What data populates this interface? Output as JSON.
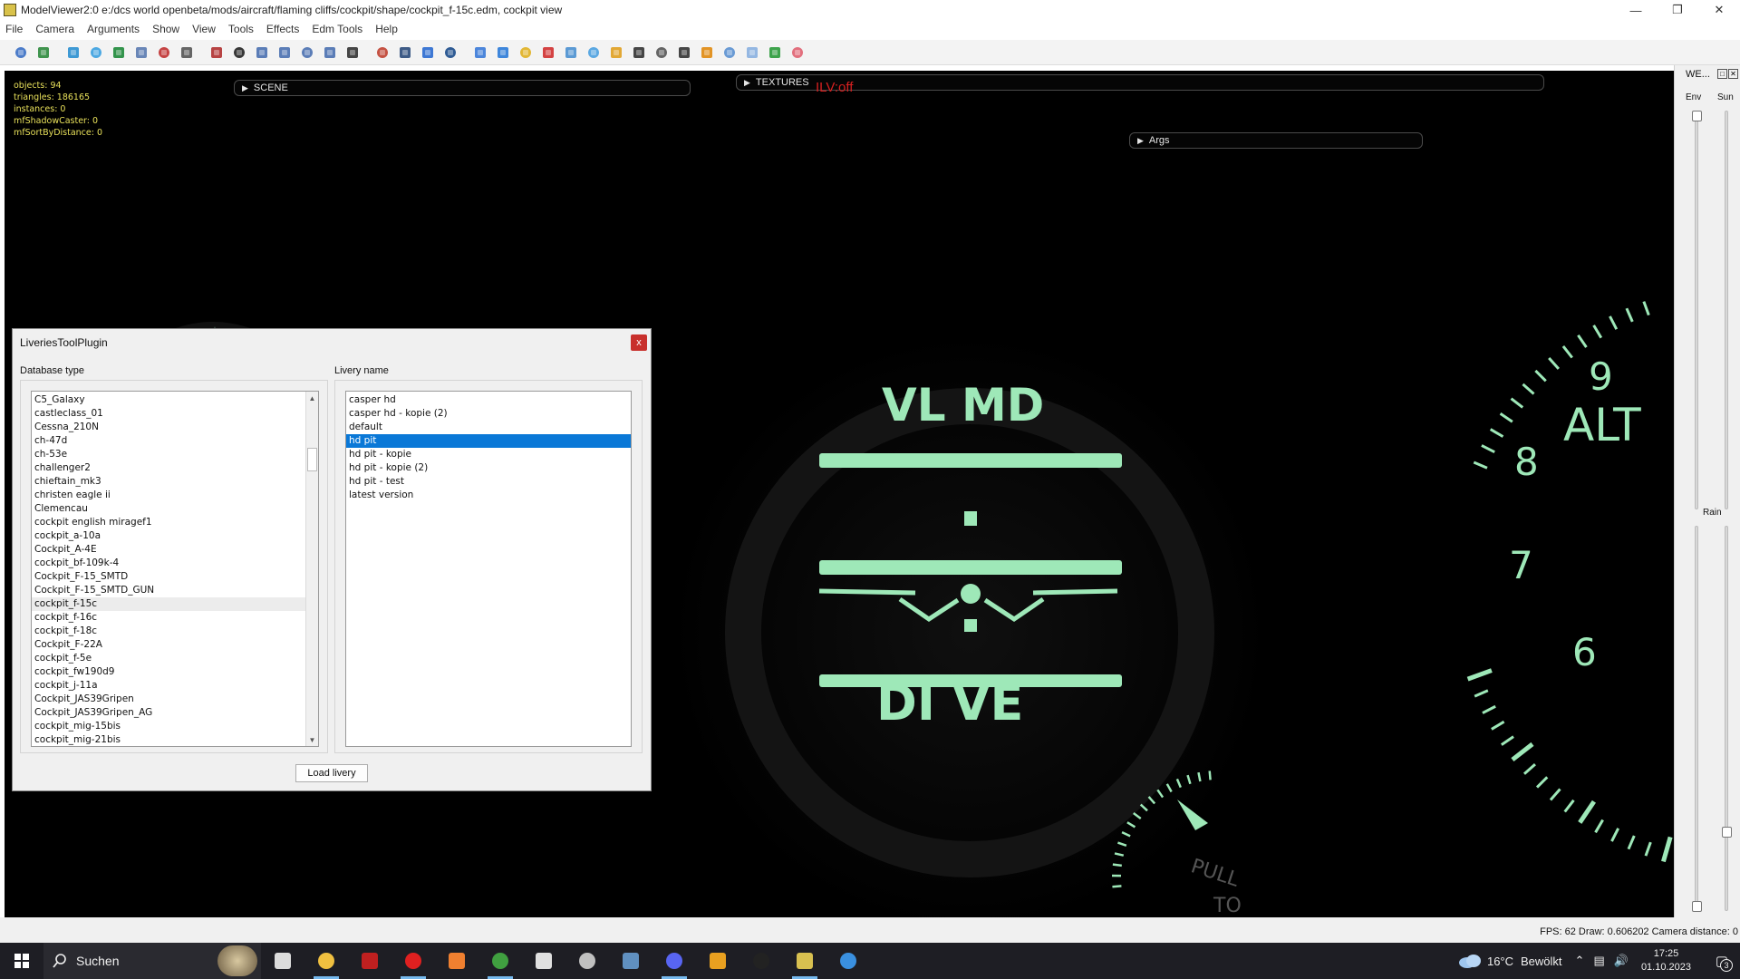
{
  "window": {
    "title": "ModelViewer2:0 e:/dcs world openbeta/mods/aircraft/flaming cliffs/cockpit/shape/cockpit_f-15c.edm, cockpit view",
    "controls": [
      "—",
      "❐",
      "✕"
    ]
  },
  "menu": [
    "File",
    "Camera",
    "Arguments",
    "Show",
    "View",
    "Tools",
    "Effects",
    "Edm Tools",
    "Help"
  ],
  "toolbar_icons": [
    "save-icon",
    "open-icon",
    "globe-icon",
    "refresh-icon",
    "reload-icon",
    "window-icon",
    "image-icon",
    "search-icon",
    "crosshair-icon",
    "grid-icon",
    "filter-icon",
    "light-icon",
    "arrow-icon",
    "sound-icon",
    "camera-icon",
    "layers-icon",
    "screen-icon",
    "undo-icon",
    "record-icon",
    "chart-icon",
    "cube-icon",
    "folder-icon",
    "box-icon",
    "panel-icon",
    "texture-icon",
    "graph-icon",
    "pin-icon",
    "hat-icon",
    "car-icon",
    "sun-icon",
    "nodes-icon",
    "mesh-icon",
    "dots-icon",
    "target-icon"
  ],
  "overlay": {
    "stats": [
      "objects: 94",
      "triangles: 186165",
      "instances: 0",
      "mfShadowCaster: 0",
      "mfSortByDistance: 0"
    ],
    "scene_label": "SCENE",
    "textures_label": "TEXTURES",
    "ilv_label": "ILV:off",
    "args_label": "Args",
    "arrow_glyph": "▶"
  },
  "cockpit": {
    "adi_top_text": "VL MD",
    "adi_bottom_text": "DI VE",
    "alt_label": "ALT",
    "alt_numbers": [
      "9",
      "8",
      "7",
      "6"
    ],
    "pull_label": "PULL",
    "to_label": "TO",
    "glow_color": "#9ee8b8"
  },
  "right_panel": {
    "title": "WE...",
    "env_label": "Env",
    "sun_label": "Sun",
    "rain_label": "Rain"
  },
  "dialog": {
    "title": "LiveriesToolPlugin",
    "close_glyph": "x",
    "database_label": "Database type",
    "livery_label": "Livery name",
    "load_button": "Load livery",
    "database_items": [
      "C5_Galaxy",
      "castleclass_01",
      "Cessna_210N",
      "ch-47d",
      "ch-53e",
      "challenger2",
      "chieftain_mk3",
      "christen eagle ii",
      "Clemencau",
      "cockpit english miragef1",
      "cockpit_a-10a",
      "Cockpit_A-4E",
      "cockpit_bf-109k-4",
      "Cockpit_F-15_SMTD",
      "Cockpit_F-15_SMTD_GUN",
      "cockpit_f-15c",
      "cockpit_f-16c",
      "cockpit_f-18c",
      "Cockpit_F-22A",
      "cockpit_f-5e",
      "cockpit_fw190d9",
      "cockpit_j-11a",
      "Cockpit_JAS39Gripen",
      "Cockpit_JAS39Gripen_AG",
      "cockpit_mig-15bis",
      "cockpit_mig-21bis"
    ],
    "database_selected": "cockpit_f-15c",
    "livery_items": [
      "casper hd",
      "casper hd - kopie (2)",
      "default",
      "hd pit",
      "hd pit - kopie",
      "hd pit - kopie (2)",
      "hd pit - test",
      "latest version"
    ],
    "livery_selected": "hd pit",
    "scroll_glyph_up": "▲",
    "scroll_glyph_down": "▼"
  },
  "status_bar": {
    "text": "FPS: 62  Draw: 0.606202  Camera distance: 0"
  },
  "taskbar": {
    "search_label": "Suchen",
    "apps": [
      "task-view-icon",
      "file-explorer-icon",
      "red-app-icon",
      "opera-icon",
      "media-player-icon",
      "xbox-icon",
      "settings-icon",
      "headset-icon",
      "notepad-icon",
      "discord-icon",
      "browser-icon",
      "dcs-icon",
      "modelviewer-icon",
      "paint-icon"
    ],
    "weather_temp": "16°C",
    "weather_text": "Bewölkt",
    "time": "17:25",
    "date": "01.10.2023",
    "notification_count": "3"
  }
}
